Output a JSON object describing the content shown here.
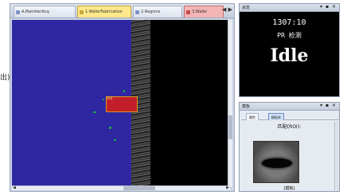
{
  "left_edge": {
    "text": "出)"
  },
  "main_window": {
    "tabs": [
      {
        "label": "A.MainIterAcq",
        "dot": "#7d94c4"
      },
      {
        "label": "1.WaferFabrication",
        "dot": "#c9a23a"
      },
      {
        "label": "2.Regions",
        "dot": "#7d94c4"
      },
      {
        "label": "3.Wafer",
        "dot": "#c44a4a"
      }
    ],
    "tab_arrows": "◀ ▶",
    "roi_label": "ROI"
  },
  "status_window": {
    "title": "状态",
    "buttons": "▾ ▪ ✕",
    "line1": "1307:10",
    "line2": "PR 检测",
    "state": "Idle"
  },
  "template_window": {
    "title": "模板",
    "buttons": "▾ ▪ ✕",
    "subtabs": [
      "属性",
      "模板库"
    ],
    "header": "匹配(ROI):",
    "caption": "[模板]"
  },
  "colors": {
    "blue_region": "#2f27a2",
    "roi_fill": "#c21f2b",
    "roi_border": "#d69a1a"
  }
}
